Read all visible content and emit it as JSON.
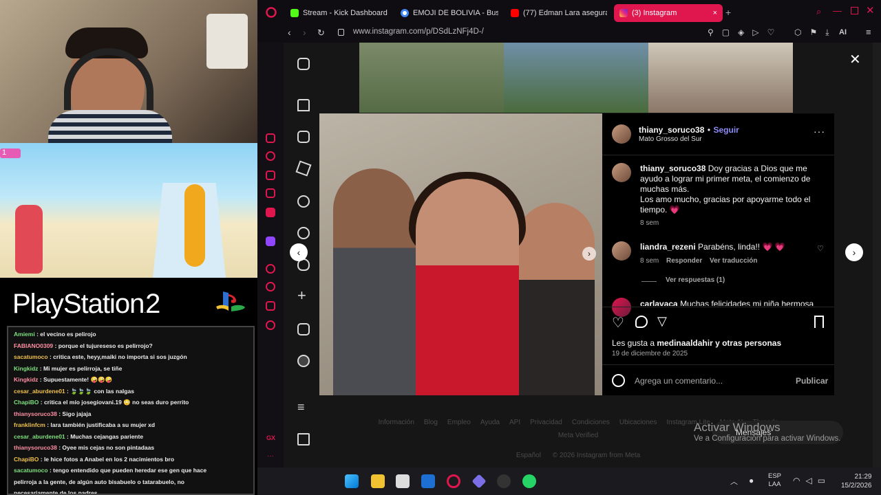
{
  "colors": {
    "accent": "#e0164f",
    "ig_blue": "#8e8cf8",
    "bg": "#161616"
  },
  "browser": {
    "tabs": [
      {
        "label": "Stream - Kick Dashboard",
        "icon": "kick-icon"
      },
      {
        "label": "EMOJI DE BOLIVIA - Busc",
        "icon": "google-icon"
      },
      {
        "label": "(77) Edman Lara asegura",
        "icon": "youtube-icon"
      },
      {
        "label": "(3) Instagram",
        "icon": "instagram-icon"
      }
    ],
    "url": "www.instagram.com/p/DSdLzNFj4D-/",
    "ai_label": "AI"
  },
  "overlay": {
    "game_hud_count": "1",
    "playstation_logo": "PlayStation",
    "playstation_version": "2",
    "chat": [
      {
        "user": "Amiemi",
        "text": ": el vecino es pelirojo"
      },
      {
        "user": "FABIANO0309",
        "text": ": porque el tujureseso es pelirrojo?"
      },
      {
        "user": "sacatumoco",
        "text": ": critica este, heyy,maiki no importa si sos juzgón"
      },
      {
        "user": "Kingkidz",
        "text": ": Mi mujer es pelirroja, se tiñe"
      },
      {
        "user": "Kingkidz",
        "text": ": Supuestamente! 🤪🤪🤪"
      },
      {
        "user": "cesar_aburdene01",
        "text": ": 🍃🍃🍃 con las nalgas"
      },
      {
        "user": "ChapiBO",
        "text": ": critica el mío josegiovani.19 😳 no seas duro perrito"
      },
      {
        "user": "thianysoruco38",
        "text": ": Sigo jajaja"
      },
      {
        "user": "franklinfcm",
        "text": ": lara también justificaba a su mujer xd"
      },
      {
        "user": "cesar_aburdene01",
        "text": ": Muchas cejangas pariente"
      },
      {
        "user": "thianysoruco38",
        "text": ": Oyee mis cejas no son pintadaas"
      },
      {
        "user": "ChapiBO",
        "text": ": le hice fotos a Anabel en los 2 nacimientos bro"
      },
      {
        "user": "sacatumoco",
        "text": ": tengo entendido que pueden heredar ese gen que hace"
      },
      {
        "user": "",
        "text": "pelirroja a la gente, de algún auto bisabuelo o tatarabuelo, no"
      },
      {
        "user": "",
        "text": "necesariamente de los padres"
      }
    ]
  },
  "post": {
    "author": "thiany_soruco38",
    "dot": "•",
    "follow_label": "Seguir",
    "location": "Mato Grosso del Sur",
    "caption_user": "thiany_soruco38",
    "caption_line1": "Doy gracias a Dios que me",
    "caption_line2": "ayudo a lograr mi primer meta, el comienzo de",
    "caption_line3": "muchas más.",
    "caption_line4": "Los amo mucho, gracias por apoyarme todo el",
    "caption_line5": "tiempo. 💗",
    "caption_time": "8 sem",
    "comments": [
      {
        "user": "liandra_rezeni",
        "text": "Parabéns, linda!! 💗 💗",
        "time": "8 sem",
        "reply": "Responder",
        "translate": "Ver traducción",
        "replies": "Ver respuestas (1)"
      },
      {
        "user": "carlavaca",
        "text": "Muchas felicidades mi niña hermosa"
      }
    ],
    "likes_prefix": "Les gusta a",
    "likes_user": "medinaaldahir",
    "likes_suffix": "y otras personas",
    "date": "19 de diciembre de 2025",
    "comment_placeholder": "Agrega un comentario...",
    "publish_label": "Publicar"
  },
  "footer": {
    "links": [
      "Información",
      "Blog",
      "Empleo",
      "Ayuda",
      "API",
      "Privacidad",
      "Condiciones",
      "Ubicaciones",
      "Instagram Lite",
      "Meta AI",
      "Threads"
    ],
    "meta_verified": "Meta Verified",
    "language": "Español",
    "copyright": "© 2026 Instagram from Meta"
  },
  "messages_label": "Mensajes",
  "windows": {
    "activate_title": "Activar Windows",
    "activate_sub": "Ve a Configuración para activar Windows.",
    "lang": "ESP",
    "lang2": "LAA",
    "time": "21:29",
    "date": "15/2/2026"
  }
}
